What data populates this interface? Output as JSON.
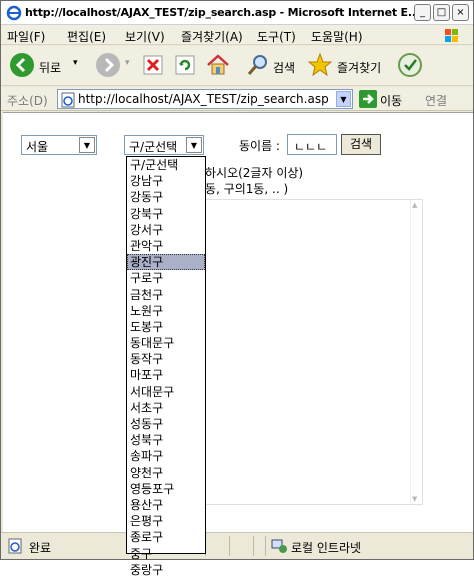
{
  "window": {
    "title": "http://localhost/AJAX_TEST/zip_search.asp - Microsoft Internet E...",
    "controls": {
      "minimize": "_",
      "maximize": "□",
      "close": "×"
    }
  },
  "menu": [
    "파일(F)",
    "편집(E)",
    "보기(V)",
    "즐겨찾기(A)",
    "도구(T)",
    "도움말(H)"
  ],
  "toolbar": {
    "back_label": "뒤로",
    "search_label": "검색",
    "favorites_label": "즐겨찾기"
  },
  "address": {
    "label": "주소(D)",
    "url": "http://localhost/AJAX_TEST/zip_search.asp",
    "go_label": "이동",
    "links_label": "연결"
  },
  "form": {
    "city_value": "서울",
    "district_value": "구/군선택",
    "dong_label": "동이름 :",
    "dong_value": "ㄴㄴㄴ",
    "search_button": "검색",
    "hint_line1": "하시오(2글자 이상)",
    "hint_line2": "동, 구의1동, .. )"
  },
  "district_options": [
    "구/군선택",
    "강남구",
    "강동구",
    "강북구",
    "강서구",
    "관악구",
    "광진구",
    "구로구",
    "금천구",
    "노원구",
    "도봉구",
    "동대문구",
    "동작구",
    "마포구",
    "서대문구",
    "서초구",
    "성동구",
    "성북구",
    "송파구",
    "양천구",
    "영등포구",
    "용산구",
    "은평구",
    "종로구",
    "중구",
    "중랑구"
  ],
  "highlighted_option": "광진구",
  "status": {
    "done": "완료",
    "zone": "로컬 인트라넷"
  }
}
